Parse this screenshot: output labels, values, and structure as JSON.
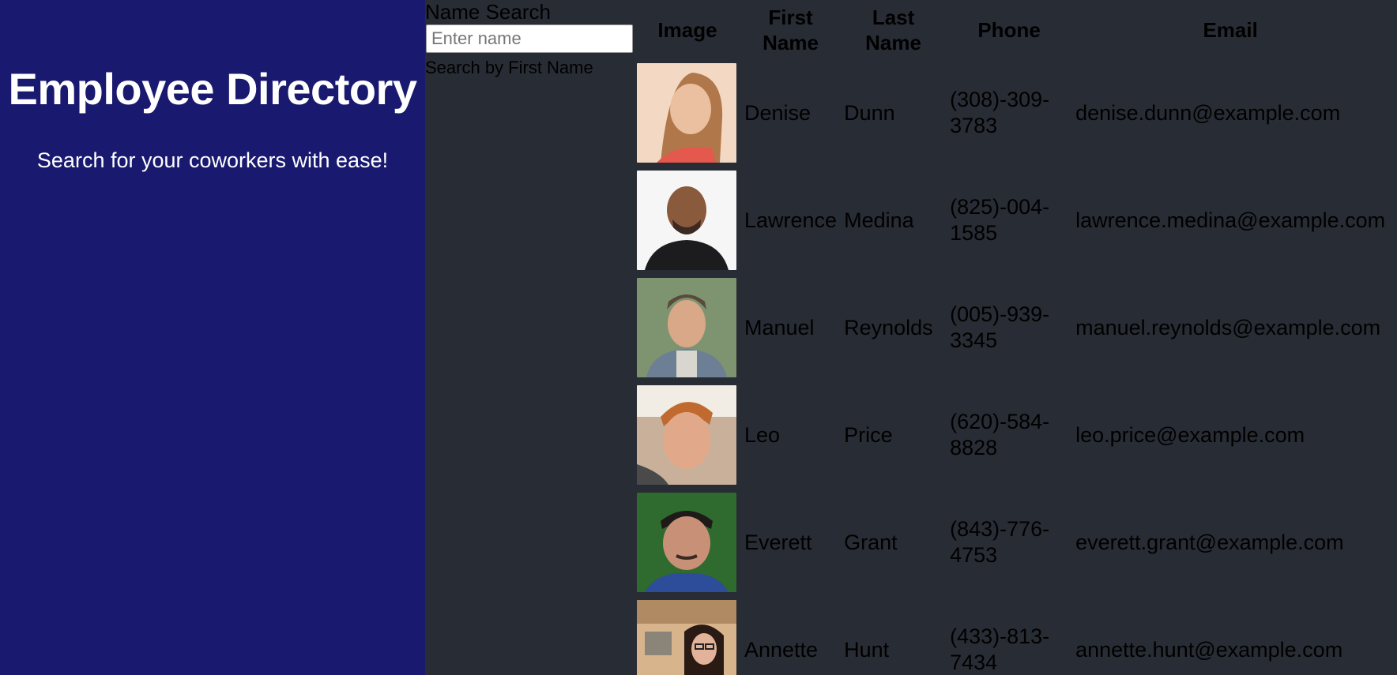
{
  "hero": {
    "title": "Employee Directory",
    "subtitle": "Search for your coworkers with ease!"
  },
  "search": {
    "label": "Name Search",
    "placeholder": "Enter name",
    "hint": "Search by First Name"
  },
  "table": {
    "headers": {
      "image": "Image",
      "first": "First Name",
      "last": "Last Name",
      "phone": "Phone",
      "email": "Email"
    },
    "rows": [
      {
        "first": "Denise",
        "last": "Dunn",
        "phone": "(308)-309-3783",
        "email": "denise.dunn@example.com"
      },
      {
        "first": "Lawrence",
        "last": "Medina",
        "phone": "(825)-004-1585",
        "email": "lawrence.medina@example.com"
      },
      {
        "first": "Manuel",
        "last": "Reynolds",
        "phone": "(005)-939-3345",
        "email": "manuel.reynolds@example.com"
      },
      {
        "first": "Leo",
        "last": "Price",
        "phone": "(620)-584-8828",
        "email": "leo.price@example.com"
      },
      {
        "first": "Everett",
        "last": "Grant",
        "phone": "(843)-776-4753",
        "email": "everett.grant@example.com"
      },
      {
        "first": "Annette",
        "last": "Hunt",
        "phone": "(433)-813-7434",
        "email": "annette.hunt@example.com"
      }
    ]
  }
}
